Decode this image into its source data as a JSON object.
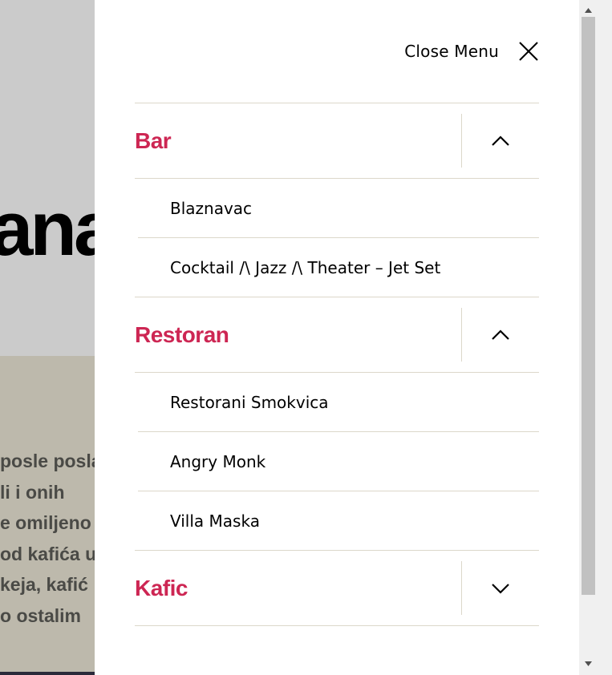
{
  "background": {
    "hero_title_fragment": "ana",
    "paragraph_lines": [
      "posle posla",
      "li i onih",
      "e omiljeno",
      "od kafića u",
      "keja, kafić",
      "o ostalim"
    ]
  },
  "menu": {
    "close_label": "Close Menu",
    "items": [
      {
        "label": "Bar",
        "expanded": true,
        "children": [
          {
            "label": "Blaznavac"
          },
          {
            "label": "Cocktail /\\ Jazz /\\ Theater – Jet Set"
          }
        ]
      },
      {
        "label": "Restoran",
        "expanded": true,
        "children": [
          {
            "label": "Restorani Smokvica"
          },
          {
            "label": "Angry Monk"
          },
          {
            "label": "Villa Maska"
          }
        ]
      },
      {
        "label": "Kafic",
        "expanded": false,
        "children": []
      }
    ]
  },
  "colors": {
    "accent": "#cd2653",
    "divider": "#dcd7ca",
    "hero_bg": "#cbcbcb",
    "content_bg": "#bdb9ac"
  },
  "icons": {
    "close": "close-icon",
    "expanded": "chevron-up-icon",
    "collapsed": "chevron-down-icon"
  }
}
